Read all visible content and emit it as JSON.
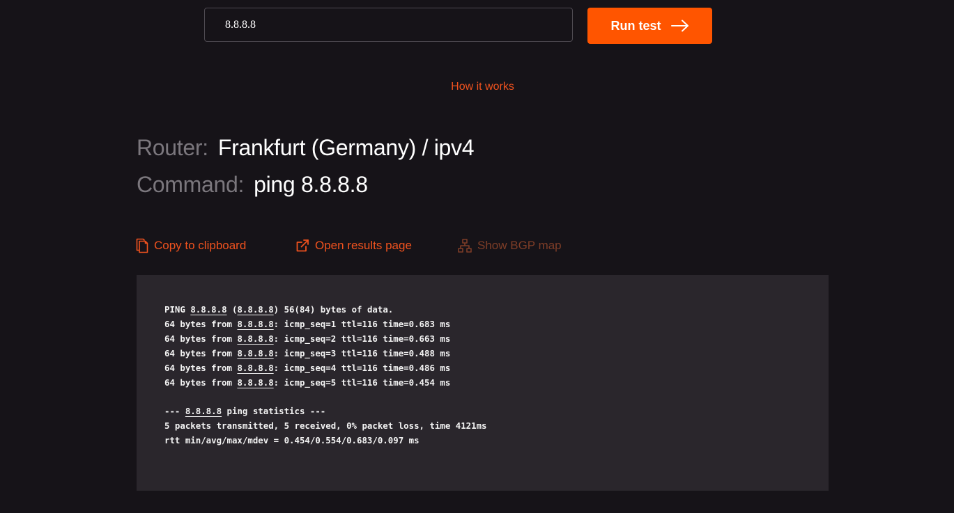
{
  "search": {
    "value": "8.8.8.8"
  },
  "run_button": {
    "label": "Run test",
    "icon": "arrow-right-icon"
  },
  "how_it_works": "How it works",
  "router": {
    "label": "Router:",
    "value": "Frankfurt (Germany) / ipv4"
  },
  "command": {
    "label": "Command:",
    "value": "ping 8.8.8.8"
  },
  "actions": {
    "copy": {
      "label": "Copy to clipboard",
      "icon": "copy-icon"
    },
    "open": {
      "label": "Open results page",
      "icon": "external-link-icon"
    },
    "bgp": {
      "label": "Show BGP map",
      "icon": "sitemap-icon"
    }
  },
  "colors": {
    "background": "#161318",
    "accent": "#ff5500",
    "link": "#f0521e",
    "disabled_link": "#7e3d27",
    "terminal_bg": "#2a262c"
  },
  "output": {
    "ip": "8.8.8.8",
    "lines": [
      {
        "pre": "PING ",
        "link": "8.8.8.8",
        "mid": " (",
        "link2": "8.8.8.8",
        "post": ") 56(84) bytes of data."
      },
      {
        "pre": "64 bytes from ",
        "link": "8.8.8.8",
        "post": ": icmp_seq=1 ttl=116 time=0.683 ms"
      },
      {
        "pre": "64 bytes from ",
        "link": "8.8.8.8",
        "post": ": icmp_seq=2 ttl=116 time=0.663 ms"
      },
      {
        "pre": "64 bytes from ",
        "link": "8.8.8.8",
        "post": ": icmp_seq=3 ttl=116 time=0.488 ms"
      },
      {
        "pre": "64 bytes from ",
        "link": "8.8.8.8",
        "post": ": icmp_seq=4 ttl=116 time=0.486 ms"
      },
      {
        "pre": "64 bytes from ",
        "link": "8.8.8.8",
        "post": ": icmp_seq=5 ttl=116 time=0.454 ms"
      },
      {
        "pre": ""
      },
      {
        "pre": "--- ",
        "link": "8.8.8.8",
        "post": " ping statistics ---"
      },
      {
        "pre": "5 packets transmitted, 5 received, 0% packet loss, time 4121ms"
      },
      {
        "pre": "rtt min/avg/max/mdev = 0.454/0.554/0.683/0.097 ms"
      }
    ]
  }
}
